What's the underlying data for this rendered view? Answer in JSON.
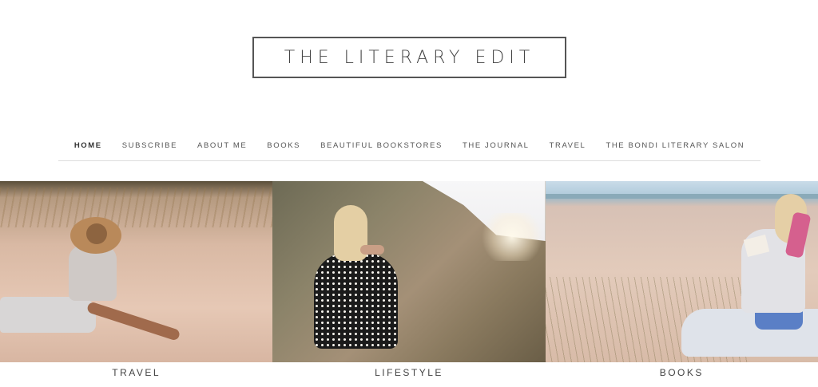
{
  "logo": {
    "text": "THE LITERARY EDIT"
  },
  "nav": {
    "items": [
      {
        "label": "HOME",
        "active": true
      },
      {
        "label": "SUBSCRIBE"
      },
      {
        "label": "ABOUT ME"
      },
      {
        "label": "BOOKS"
      },
      {
        "label": "BEAUTIFUL BOOKSTORES"
      },
      {
        "label": "THE JOURNAL"
      },
      {
        "label": "TRAVEL"
      },
      {
        "label": "THE BONDI LITERARY SALON"
      }
    ]
  },
  "tiles": [
    {
      "caption": "TRAVEL"
    },
    {
      "caption": "LIFESTYLE"
    },
    {
      "caption": "BOOKS"
    }
  ],
  "colors": {
    "text": "#444444",
    "border": "#555555",
    "rule": "#dcdcdc",
    "background": "#ffffff"
  }
}
